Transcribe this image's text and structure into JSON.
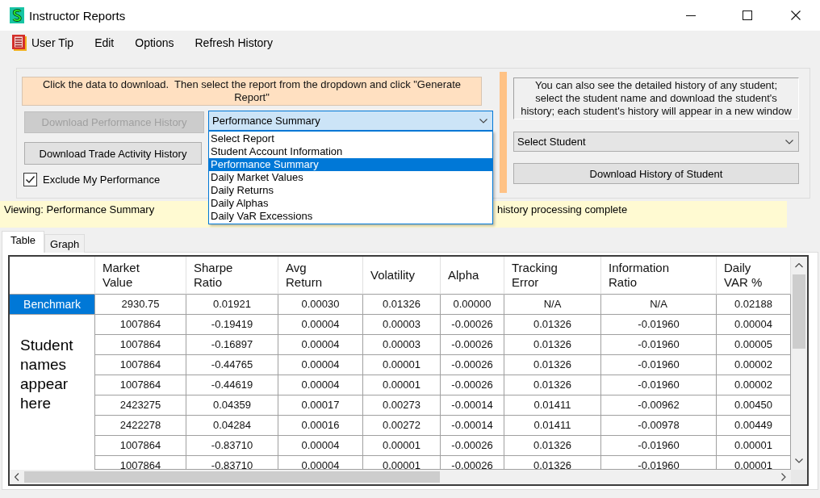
{
  "window": {
    "title": "Instructor Reports"
  },
  "menu": [
    {
      "label": "User Tip",
      "kind": "icon"
    },
    {
      "label": "Edit",
      "kind": "text"
    },
    {
      "label": "Options",
      "kind": "text"
    },
    {
      "label": "Refresh History",
      "kind": "text"
    }
  ],
  "report_panel": {
    "instructions": "Click the data to download.  Then select the report from the dropdown and click \"Generate\nReport\"",
    "buttons": [
      {
        "label": "Download Performance History",
        "disabled": true
      },
      {
        "label": "Download Trade Activity History",
        "disabled": false
      }
    ],
    "exclude_checkbox": {
      "label": "Exclude My Performance",
      "checked": true
    },
    "report_dropdown": {
      "value": "Performance Summary",
      "expanded": true,
      "options": [
        {
          "label": "Select Report",
          "selected": false
        },
        {
          "label": "Student Account Information",
          "selected": false
        },
        {
          "label": "Performance Summary",
          "selected": true
        },
        {
          "label": "Daily Market Values",
          "selected": false
        },
        {
          "label": "Daily Returns",
          "selected": false
        },
        {
          "label": "Daily Alphas",
          "selected": false
        },
        {
          "label": "Daily VaR Excessions",
          "selected": false
        }
      ]
    }
  },
  "student_panel": {
    "info": "You can also see the detailed history of any student;\nselect the student name and download the student's\nhistory; each student's history will appear in a new window",
    "student_dropdown": {
      "value": "Select Student"
    },
    "download_button": {
      "label": "Download History of Student"
    }
  },
  "status_bar": {
    "viewing": "Viewing: Performance Summary",
    "message": "history processing complete"
  },
  "tabs": [
    {
      "label": "Table",
      "selected": true
    },
    {
      "label": "Graph",
      "selected": false
    }
  ],
  "table": {
    "columns": [
      "Market\nValue",
      "Sharpe\nRatio",
      "Avg\nReturn",
      "Volatility",
      "Alpha",
      "Tracking\nError",
      "Information\nRatio",
      "Daily\nVAR %"
    ],
    "benchmark": {
      "label": "Benchmark",
      "selected": true,
      "cells": [
        "2930.75",
        "0.01921",
        "0.00030",
        "0.01326",
        "0.00000",
        "N/A",
        "N/A",
        "0.02188"
      ]
    },
    "student_header_note": "Student names appear here",
    "rows": [
      {
        "cells": [
          "1007864",
          "-0.19419",
          "0.00004",
          "0.00003",
          "-0.00026",
          "0.01326",
          "-0.01960",
          "0.00004"
        ]
      },
      {
        "cells": [
          "1007864",
          "-0.16897",
          "0.00004",
          "0.00003",
          "-0.00026",
          "0.01326",
          "-0.01960",
          "0.00005"
        ]
      },
      {
        "cells": [
          "1007864",
          "-0.44765",
          "0.00004",
          "0.00001",
          "-0.00026",
          "0.01326",
          "-0.01960",
          "0.00002"
        ]
      },
      {
        "cells": [
          "1007864",
          "-0.44619",
          "0.00004",
          "0.00001",
          "-0.00026",
          "0.01326",
          "-0.01960",
          "0.00002"
        ]
      },
      {
        "cells": [
          "2423275",
          "0.04359",
          "0.00017",
          "0.00273",
          "-0.00014",
          "0.01411",
          "-0.00962",
          "0.00450"
        ]
      },
      {
        "cells": [
          "2422278",
          "0.04284",
          "0.00016",
          "0.00272",
          "-0.00014",
          "0.01411",
          "-0.00978",
          "0.00449"
        ]
      },
      {
        "cells": [
          "1007864",
          "-0.83710",
          "0.00004",
          "0.00001",
          "-0.00026",
          "0.01326",
          "-0.01960",
          "0.00001"
        ]
      },
      {
        "cells": [
          "1007864",
          "-0.83710",
          "0.00004",
          "0.00001",
          "-0.00026",
          "0.01326",
          "-0.01960",
          "0.00001"
        ]
      }
    ]
  }
}
